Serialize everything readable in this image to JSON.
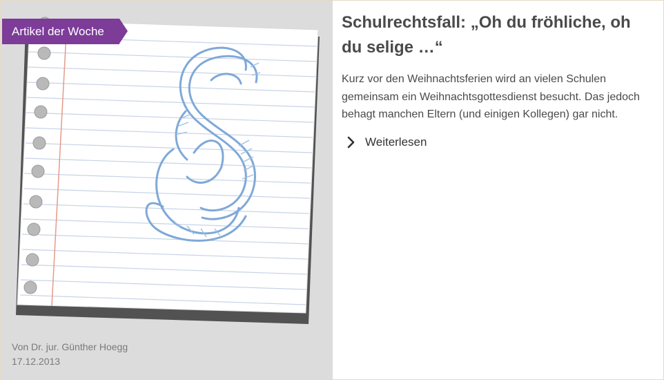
{
  "badge": {
    "label": "Artikel der Woche",
    "color": "#7d3c98"
  },
  "article": {
    "title": "Schulrechtsfall: „Oh du fröhliche, oh du selige …“",
    "teaser": "Kurz vor den Weihnachtsferien wird an vielen Schulen gemeinsam ein Weihnachtsgottesdienst besucht. Das jedoch behagt manchen Eltern (und einigen Kollegen) gar nicht.",
    "read_more": "Weiterlesen",
    "author": "Von Dr. jur. Günther Hoegg",
    "date": "17.12.2013"
  },
  "image": {
    "subject": "paragraph-sign-on-notepad",
    "accent": "#7fa8d8"
  },
  "icons": {
    "read_more": "chevron-right-icon"
  }
}
